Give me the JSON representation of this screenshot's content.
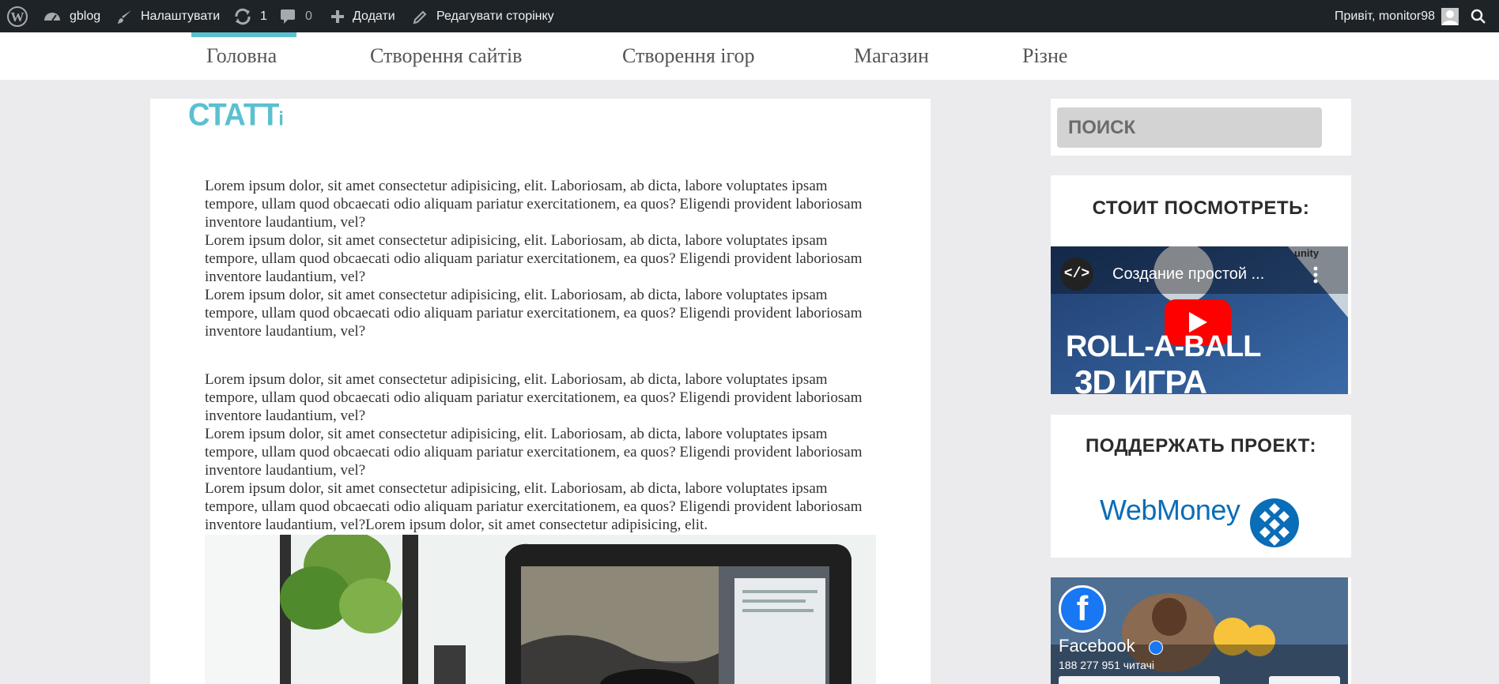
{
  "adminbar": {
    "site_name": "gblog",
    "customize": "Налаштувати",
    "updates_count": "1",
    "comments_count": "0",
    "add_new": "Додати",
    "edit_page": "Редагувати сторінку",
    "greeting": "Привіт, monitor98"
  },
  "nav": {
    "items": [
      {
        "label": "Головна",
        "active": true
      },
      {
        "label": "Створення сайтів"
      },
      {
        "label": "Створення ігор"
      },
      {
        "label": "Магазин"
      },
      {
        "label": "Різне"
      }
    ]
  },
  "main": {
    "title_main": "СТАТТ",
    "title_tail": "і",
    "paragraphs": [
      "Lorem ipsum dolor, sit amet consectetur adipisicing, elit. Laboriosam, ab dicta, labore voluptates ipsam tempore, ullam quod obcaecati odio aliquam pariatur exercitationem, ea quos? Eligendi provident laboriosam inventore laudantium, vel?",
      "Lorem ipsum dolor, sit amet consectetur adipisicing, elit. Laboriosam, ab dicta, labore voluptates ipsam tempore, ullam quod obcaecati odio aliquam pariatur exercitationem, ea quos? Eligendi provident laboriosam inventore laudantium, vel?",
      "Lorem ipsum dolor, sit amet consectetur adipisicing, elit. Laboriosam, ab dicta, labore voluptates ipsam tempore, ullam quod obcaecati odio aliquam pariatur exercitationem, ea quos? Eligendi provident laboriosam inventore laudantium, vel?",
      "Lorem ipsum dolor, sit amet consectetur adipisicing, elit. Laboriosam, ab dicta, labore voluptates ipsam tempore, ullam quod obcaecati odio aliquam pariatur exercitationem, ea quos? Eligendi provident laboriosam inventore laudantium, vel?",
      "Lorem ipsum dolor, sit amet consectetur adipisicing, elit. Laboriosam, ab dicta, labore voluptates ipsam tempore, ullam quod obcaecati odio aliquam pariatur exercitationem, ea quos? Eligendi provident laboriosam inventore laudantium, vel?",
      "Lorem ipsum dolor, sit amet consectetur adipisicing, elit. Laboriosam, ab dicta, labore voluptates ipsam tempore, ullam quod obcaecati odio aliquam pariatur exercitationem, ea quos? Eligendi provident laboriosam inventore laudantium, vel?Lorem ipsum dolor, sit amet consectetur adipisicing, elit."
    ]
  },
  "sidebar": {
    "search_placeholder": "ПОИСК",
    "watch_title": "СТОИТ ПОСМОТРЕТЬ:",
    "video": {
      "title": "Создание простой ...",
      "brand": "unity",
      "overlay_line1": "ROLL-A-BALL",
      "overlay_line2": "3D ИГРА"
    },
    "support_title": "ПОДДЕРЖАТЬ ПРОЕКТ:",
    "webmoney_label": "WebMoney",
    "facebook": {
      "name": "Facebook",
      "followers": "188 277 951 читачі"
    }
  },
  "colors": {
    "accent": "#5bc0d0",
    "adminbar_bg": "#1d2327",
    "page_bg": "#ebebed",
    "youtube_red": "#ff0000",
    "webmoney_blue": "#0a6db7"
  }
}
